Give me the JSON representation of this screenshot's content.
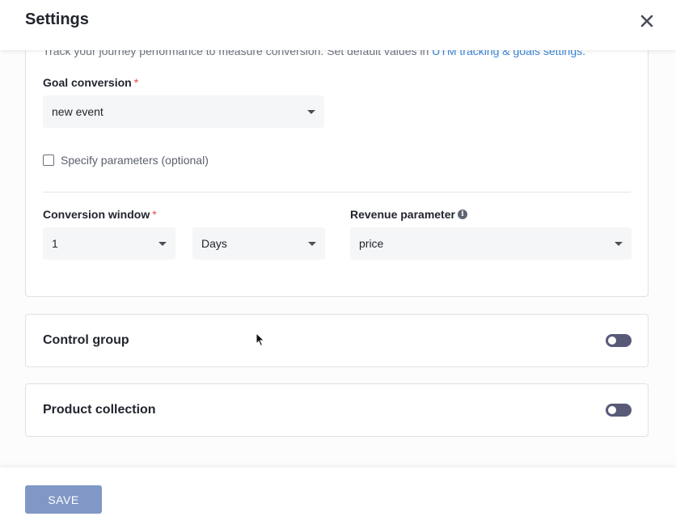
{
  "header": {
    "title": "Settings",
    "close_icon": "close-icon"
  },
  "goals": {
    "intro_text": "Track your journey performance to measure conversion. Set default values in ",
    "intro_link": "UTM tracking & goals settings.",
    "goal_conversion": {
      "label": "Goal conversion",
      "required_mark": "*",
      "selected": "new event"
    },
    "specify_parameters": {
      "label": "Specify parameters (optional)",
      "checked": false
    },
    "conversion_window": {
      "label": "Conversion window",
      "required_mark": "*",
      "amount": "1",
      "unit": "Days"
    },
    "revenue_parameter": {
      "label": "Revenue parameter",
      "info_icon": "info-icon",
      "selected": "price"
    }
  },
  "control_group": {
    "title": "Control group",
    "enabled": false
  },
  "product_collection": {
    "title": "Product collection",
    "enabled": false
  },
  "footer": {
    "save_label": "SAVE"
  },
  "colors": {
    "accent": "#3a85d8",
    "required": "#e24b4b",
    "toggle_off": "#585a78",
    "save_button": "#8198c7"
  }
}
